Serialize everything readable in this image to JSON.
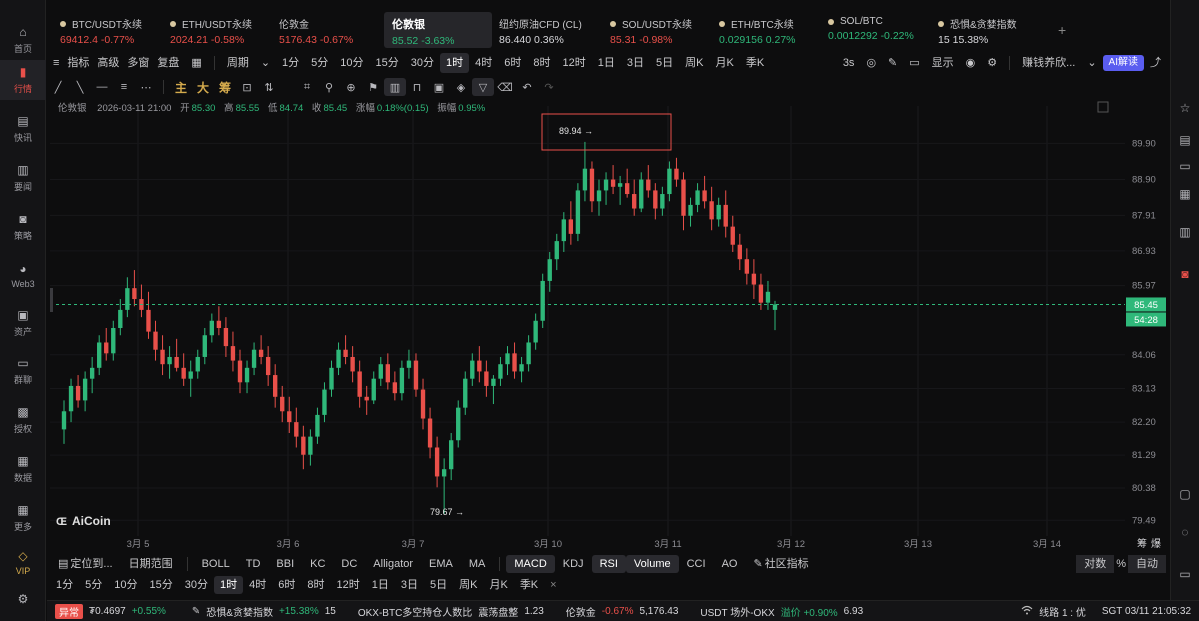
{
  "nav": {
    "items": [
      {
        "label": "首页",
        "icon": "home-icon"
      },
      {
        "label": "行情",
        "icon": "chart-bars-icon"
      },
      {
        "label": "快讯",
        "icon": "flash-news-icon"
      },
      {
        "label": "要闻",
        "icon": "document-icon"
      },
      {
        "label": "策略",
        "icon": "robot-icon"
      },
      {
        "label": "Web3",
        "icon": "web3-icon"
      },
      {
        "label": "资产",
        "icon": "wallet-icon"
      },
      {
        "label": "群聊",
        "icon": "chat-icon"
      },
      {
        "label": "授权",
        "icon": "authorize-icon"
      },
      {
        "label": "数据",
        "icon": "data-icon"
      },
      {
        "label": "更多",
        "icon": "grid-icon"
      },
      {
        "label": "VIP",
        "icon": "vip-diamond-icon"
      }
    ],
    "settings_icon": "settings-icon"
  },
  "tickers": [
    {
      "name": "BTC/USDT永续",
      "price": "69412.4",
      "change": "-0.77%",
      "dir": "dn"
    },
    {
      "name": "ETH/USDT永续",
      "price": "2024.21",
      "change": "-0.58%",
      "dir": "dn"
    },
    {
      "name": "伦敦金",
      "price": "5176.43",
      "change": "-0.67%",
      "dir": "dn"
    },
    {
      "name": "伦敦银",
      "price": "85.52",
      "change": "-3.63%",
      "dir": "up"
    },
    {
      "name": "纽约原油CFD (CL)",
      "price": "86.440",
      "change": "0.36%",
      "dir": "wt"
    },
    {
      "name": "SOL/USDT永续",
      "price": "85.31",
      "change": "-0.98%",
      "dir": "dn"
    },
    {
      "name": "ETH/BTC永续",
      "price": "0.029156",
      "change": "0.27%",
      "dir": "up"
    },
    {
      "name": "SOL/BTC",
      "price": "0.0012292",
      "change": "-0.22%",
      "dir": "up"
    },
    {
      "name": "恐惧&贪婪指数",
      "price": "15",
      "change": "15.38%",
      "dir": "wt"
    }
  ],
  "toolbar1": {
    "left": [
      "指标",
      "高级",
      "多窗",
      "复盘"
    ],
    "period_label": "周期",
    "intervals": [
      "1分",
      "5分",
      "10分",
      "15分",
      "30分",
      "1时",
      "4时",
      "6时",
      "8时",
      "12时",
      "1日",
      "3日",
      "5日",
      "周K",
      "月K",
      "季K"
    ],
    "active_interval": "1时",
    "speed": "3s",
    "display_label": "显示",
    "theme_label": "赚钱养欣...",
    "ai_label": "AI解读"
  },
  "toolbar2": {
    "chars": [
      "主",
      "大",
      "筹"
    ]
  },
  "chart_info": {
    "name": "伦敦银",
    "datetime": "2026-03-11 21:00",
    "open_label": "开",
    "open": "85.30",
    "high_label": "高",
    "high": "85.55",
    "low_label": "低",
    "low": "84.74",
    "close_label": "收",
    "close": "85.45",
    "change_label": "涨幅",
    "change": "0.18%(0.15)",
    "amp_label": "振幅",
    "amp": "0.95%"
  },
  "chart_data": {
    "type": "candlestick",
    "y_ticks": [
      "89.90",
      "88.90",
      "87.91",
      "86.93",
      "85.97",
      "85.45",
      "84.06",
      "83.13",
      "82.20",
      "81.29",
      "80.38",
      "79.49"
    ],
    "y_range": [
      79.0,
      90.6
    ],
    "x_ticks": [
      "3月 5",
      "3月 6",
      "3月 7",
      "3月 10",
      "3月 11",
      "3月 12",
      "3月 13",
      "3月 14"
    ],
    "current_price": "85.45",
    "countdown": "54:28",
    "high_marker": "89.94 →",
    "low_marker": "79.67 →",
    "watermark": "AiCoin",
    "candles": [
      [
        82.0,
        82.8,
        81.6,
        82.5
      ],
      [
        82.5,
        83.4,
        82.2,
        83.2
      ],
      [
        83.2,
        83.5,
        82.6,
        82.8
      ],
      [
        82.8,
        83.6,
        82.5,
        83.4
      ],
      [
        83.4,
        84.0,
        83.0,
        83.7
      ],
      [
        83.7,
        84.6,
        83.5,
        84.4
      ],
      [
        84.4,
        84.8,
        83.9,
        84.1
      ],
      [
        84.1,
        85.0,
        83.9,
        84.8
      ],
      [
        84.8,
        85.6,
        84.6,
        85.3
      ],
      [
        85.3,
        86.2,
        85.1,
        85.9
      ],
      [
        85.9,
        86.4,
        85.4,
        85.6
      ],
      [
        85.6,
        86.0,
        85.1,
        85.3
      ],
      [
        85.3,
        85.8,
        84.5,
        84.7
      ],
      [
        84.7,
        85.0,
        83.9,
        84.2
      ],
      [
        84.2,
        84.6,
        83.5,
        83.8
      ],
      [
        83.8,
        84.3,
        83.4,
        84.0
      ],
      [
        84.0,
        84.5,
        83.6,
        83.7
      ],
      [
        83.7,
        84.1,
        83.2,
        83.4
      ],
      [
        83.4,
        83.9,
        82.9,
        83.6
      ],
      [
        83.6,
        84.2,
        83.4,
        84.0
      ],
      [
        84.0,
        84.8,
        83.8,
        84.6
      ],
      [
        84.6,
        85.2,
        84.4,
        85.0
      ],
      [
        85.0,
        85.4,
        84.6,
        84.8
      ],
      [
        84.8,
        85.1,
        84.0,
        84.3
      ],
      [
        84.3,
        84.7,
        83.6,
        83.9
      ],
      [
        83.9,
        84.2,
        83.0,
        83.3
      ],
      [
        83.3,
        83.9,
        83.0,
        83.7
      ],
      [
        83.7,
        84.4,
        83.5,
        84.2
      ],
      [
        84.2,
        84.6,
        83.8,
        84.0
      ],
      [
        84.0,
        84.3,
        83.2,
        83.5
      ],
      [
        83.5,
        83.8,
        82.6,
        82.9
      ],
      [
        82.9,
        83.2,
        82.2,
        82.5
      ],
      [
        82.5,
        82.9,
        81.9,
        82.2
      ],
      [
        82.2,
        82.6,
        81.5,
        81.8
      ],
      [
        81.8,
        82.1,
        80.9,
        81.3
      ],
      [
        81.3,
        82.0,
        81.0,
        81.8
      ],
      [
        81.8,
        82.6,
        81.6,
        82.4
      ],
      [
        82.4,
        83.3,
        82.2,
        83.1
      ],
      [
        83.1,
        83.9,
        82.9,
        83.7
      ],
      [
        83.7,
        84.4,
        83.5,
        84.2
      ],
      [
        84.2,
        84.6,
        83.8,
        84.0
      ],
      [
        84.0,
        84.3,
        83.3,
        83.6
      ],
      [
        83.6,
        83.9,
        82.6,
        82.9
      ],
      [
        82.9,
        83.2,
        82.4,
        82.8
      ],
      [
        82.8,
        83.6,
        82.7,
        83.4
      ],
      [
        83.4,
        84.0,
        83.2,
        83.8
      ],
      [
        83.8,
        84.1,
        83.1,
        83.3
      ],
      [
        83.3,
        83.6,
        82.8,
        83.0
      ],
      [
        83.0,
        83.9,
        82.8,
        83.7
      ],
      [
        83.7,
        84.2,
        83.4,
        83.9
      ],
      [
        83.9,
        84.1,
        82.9,
        83.1
      ],
      [
        83.1,
        83.4,
        82.0,
        82.3
      ],
      [
        82.3,
        82.6,
        81.2,
        81.5
      ],
      [
        81.5,
        81.8,
        80.4,
        80.7
      ],
      [
        80.7,
        81.2,
        79.67,
        80.9
      ],
      [
        80.9,
        81.9,
        80.6,
        81.7
      ],
      [
        81.7,
        82.8,
        81.5,
        82.6
      ],
      [
        82.6,
        83.6,
        82.4,
        83.4
      ],
      [
        83.4,
        84.1,
        83.2,
        83.9
      ],
      [
        83.9,
        84.3,
        83.3,
        83.6
      ],
      [
        83.6,
        83.9,
        82.9,
        83.2
      ],
      [
        83.2,
        83.5,
        82.7,
        83.4
      ],
      [
        83.4,
        84.0,
        83.2,
        83.8
      ],
      [
        83.8,
        84.3,
        83.5,
        84.1
      ],
      [
        84.1,
        84.4,
        83.4,
        83.6
      ],
      [
        83.6,
        84.0,
        83.3,
        83.8
      ],
      [
        83.8,
        84.6,
        83.6,
        84.4
      ],
      [
        84.4,
        85.2,
        84.2,
        85.0
      ],
      [
        85.0,
        86.3,
        84.8,
        86.1
      ],
      [
        86.1,
        86.9,
        85.8,
        86.7
      ],
      [
        86.7,
        87.4,
        86.4,
        87.2
      ],
      [
        87.2,
        88.0,
        86.9,
        87.8
      ],
      [
        87.8,
        88.3,
        87.1,
        87.4
      ],
      [
        87.4,
        88.8,
        87.2,
        88.6
      ],
      [
        88.6,
        89.94,
        88.3,
        89.2
      ],
      [
        89.2,
        89.4,
        88.0,
        88.3
      ],
      [
        88.3,
        88.9,
        87.9,
        88.6
      ],
      [
        88.6,
        89.1,
        88.2,
        88.9
      ],
      [
        88.9,
        89.3,
        88.5,
        88.7
      ],
      [
        88.7,
        89.0,
        88.2,
        88.8
      ],
      [
        88.8,
        89.2,
        88.4,
        88.5
      ],
      [
        88.5,
        88.9,
        87.9,
        88.1
      ],
      [
        88.1,
        89.1,
        88.0,
        88.9
      ],
      [
        88.9,
        89.3,
        88.4,
        88.6
      ],
      [
        88.6,
        88.8,
        87.8,
        88.1
      ],
      [
        88.1,
        88.7,
        87.9,
        88.5
      ],
      [
        88.5,
        89.4,
        88.3,
        89.2
      ],
      [
        89.2,
        89.5,
        88.7,
        88.9
      ],
      [
        88.9,
        89.1,
        87.5,
        87.9
      ],
      [
        87.9,
        88.4,
        87.6,
        88.2
      ],
      [
        88.2,
        88.8,
        88.0,
        88.6
      ],
      [
        88.6,
        89.0,
        88.1,
        88.3
      ],
      [
        88.3,
        88.7,
        87.5,
        87.8
      ],
      [
        87.8,
        88.4,
        87.6,
        88.2
      ],
      [
        88.2,
        88.6,
        87.3,
        87.6
      ],
      [
        87.6,
        87.9,
        86.9,
        87.1
      ],
      [
        87.1,
        87.4,
        86.4,
        86.7
      ],
      [
        86.7,
        87.0,
        86.0,
        86.3
      ],
      [
        86.3,
        86.7,
        85.6,
        86.0
      ],
      [
        86.0,
        86.3,
        85.3,
        85.5
      ],
      [
        85.5,
        86.1,
        85.3,
        85.8
      ],
      [
        85.3,
        85.55,
        84.74,
        85.45
      ]
    ]
  },
  "indicators": {
    "locate_label": "定位到...",
    "range_label": "日期范围",
    "items": [
      "BOLL",
      "TD",
      "BBI",
      "KC",
      "DC",
      "Alligator",
      "EMA",
      "MA"
    ],
    "sub_items": [
      "MACD",
      "KDJ",
      "RSI",
      "Volume",
      "CCI",
      "AO"
    ],
    "community_label": "社区指标",
    "log_label": "对数",
    "pct_label": "%",
    "auto_label": "自动",
    "chip_labels": [
      "筹",
      "爆"
    ]
  },
  "interval_bar": {
    "items": [
      "1分",
      "5分",
      "10分",
      "15分",
      "30分",
      "1时",
      "4时",
      "6时",
      "8时",
      "12时",
      "1日",
      "3日",
      "5日",
      "周K",
      "月K",
      "季K"
    ],
    "active": "1时",
    "close_symbol": "×"
  },
  "status": {
    "alert_label": "异常",
    "alert_value": "₮0.4697",
    "alert_change": "+0.55%",
    "fg_label": "恐惧&贪婪指数",
    "fg_change": "+15.38%",
    "fg_value": "15",
    "okx_label": "OKX-BTC多空持仓人数比",
    "okx_state": "震荡盘整",
    "okx_value": "1.23",
    "silver_label": "伦敦金",
    "silver_change": "-0.67%",
    "silver_value": "5,176.43",
    "usdt_label": "USDT 场外-OKX",
    "usdt_prem": "溢价 +0.90%",
    "usdt_value": "6.93",
    "line_label": "线路 1 : 优",
    "time": "SGT 03/11 21:05:32"
  }
}
